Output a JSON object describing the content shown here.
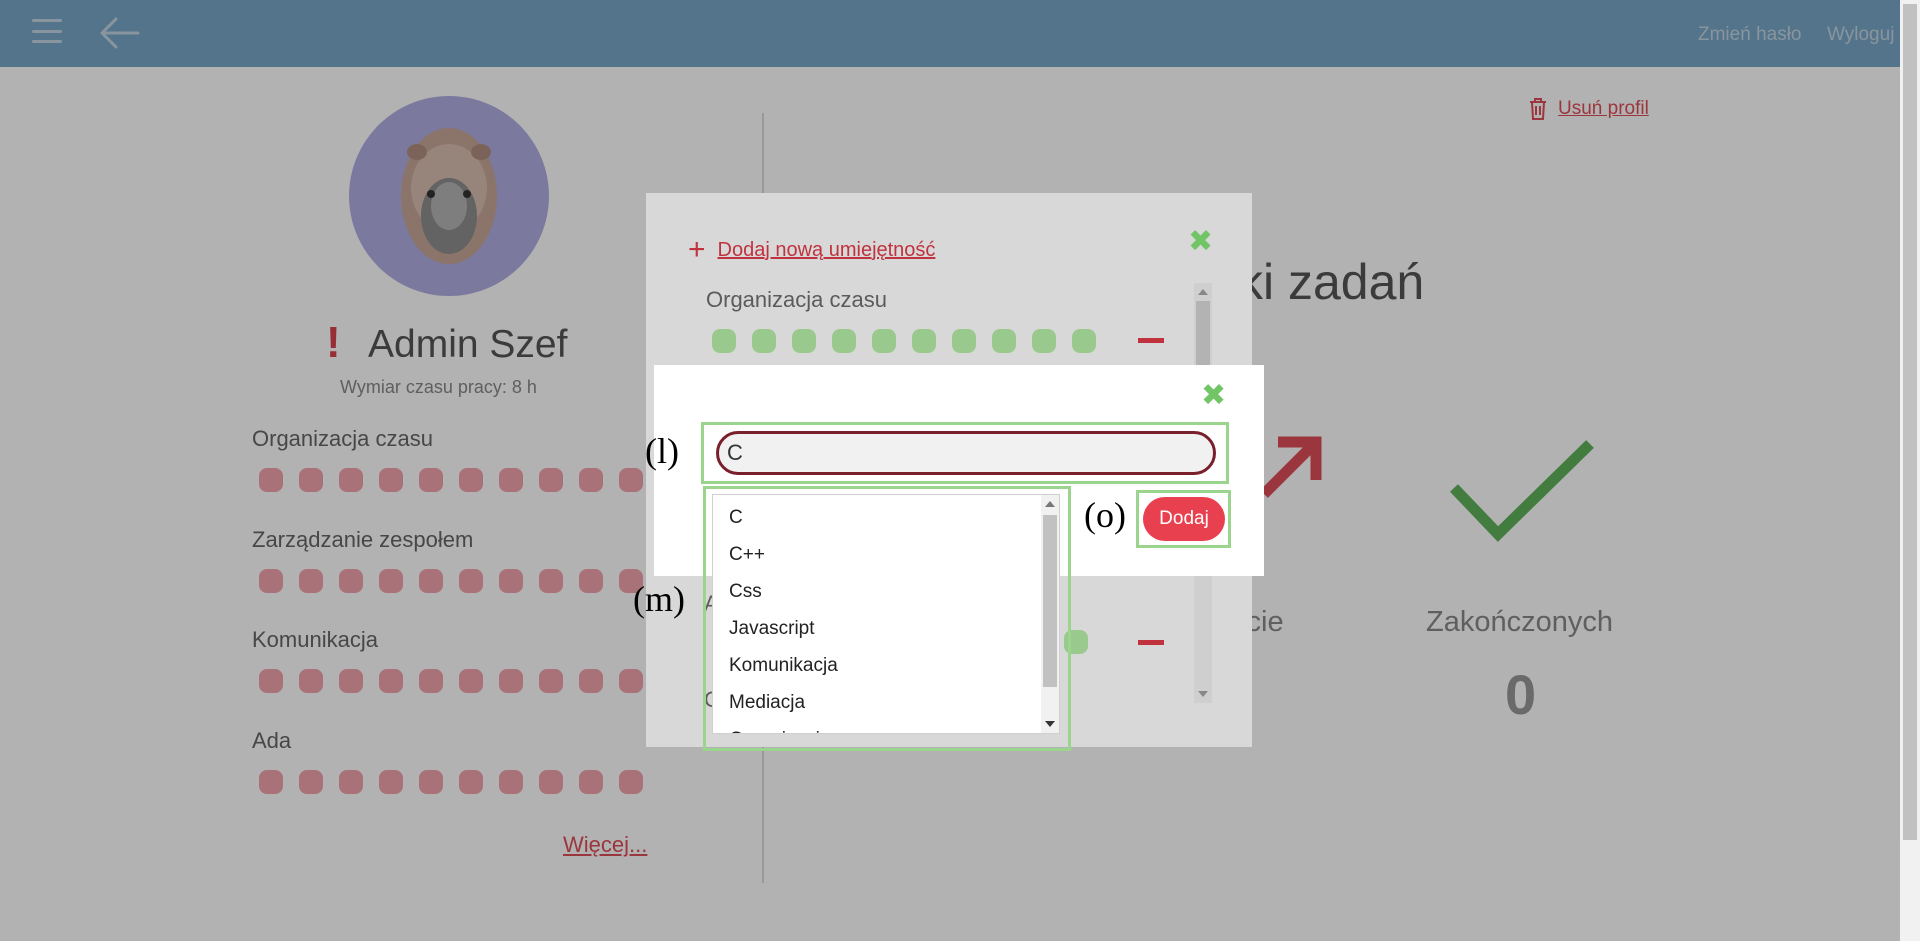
{
  "topbar": {
    "menu_icon": "hamburger-icon",
    "back_icon": "arrow-left-icon",
    "change_password": "Zmień hasło",
    "logout": "Wyloguj"
  },
  "profile": {
    "name": "Admin Szef",
    "warning_mark": "!",
    "work_time": "Wymiar czasu pracy: 8 h",
    "skills": [
      {
        "label": "Organizacja czasu",
        "level": 10
      },
      {
        "label": "Zarządzanie zespołem",
        "level": 10
      },
      {
        "label": "Komunikacja",
        "level": 10
      },
      {
        "label": "Ada",
        "level": 10
      }
    ],
    "more_link": "Więcej..."
  },
  "right": {
    "delete_profile": "Usuń profil",
    "tasks_title_fragment": "ki zadań",
    "in_progress_fragment": "kcie",
    "completed_label": "Zakończonych",
    "completed_value": "0"
  },
  "skills_modal": {
    "add_skill": "Dodaj nową umiejętność",
    "skills": [
      {
        "label": "Organizacja czasu",
        "level": 10
      }
    ],
    "partial_letter_a": "A",
    "partial_letter_c": "C"
  },
  "add_dialog": {
    "search_value": "C",
    "add_button": "Dodaj",
    "options": [
      "C",
      "C++",
      "Css",
      "Javascript",
      "Komunikacja",
      "Mediacja",
      "Organizacja"
    ]
  },
  "annotations": {
    "l": "(l)",
    "m": "(m)",
    "o": "(o)"
  },
  "colors": {
    "topbar": "#78a6c8",
    "accent_red": "#e9404f",
    "skill_dot_pink": "#f2a3ad",
    "skill_dot_green": "#99c98d",
    "highlight_green": "#9bd58d"
  }
}
